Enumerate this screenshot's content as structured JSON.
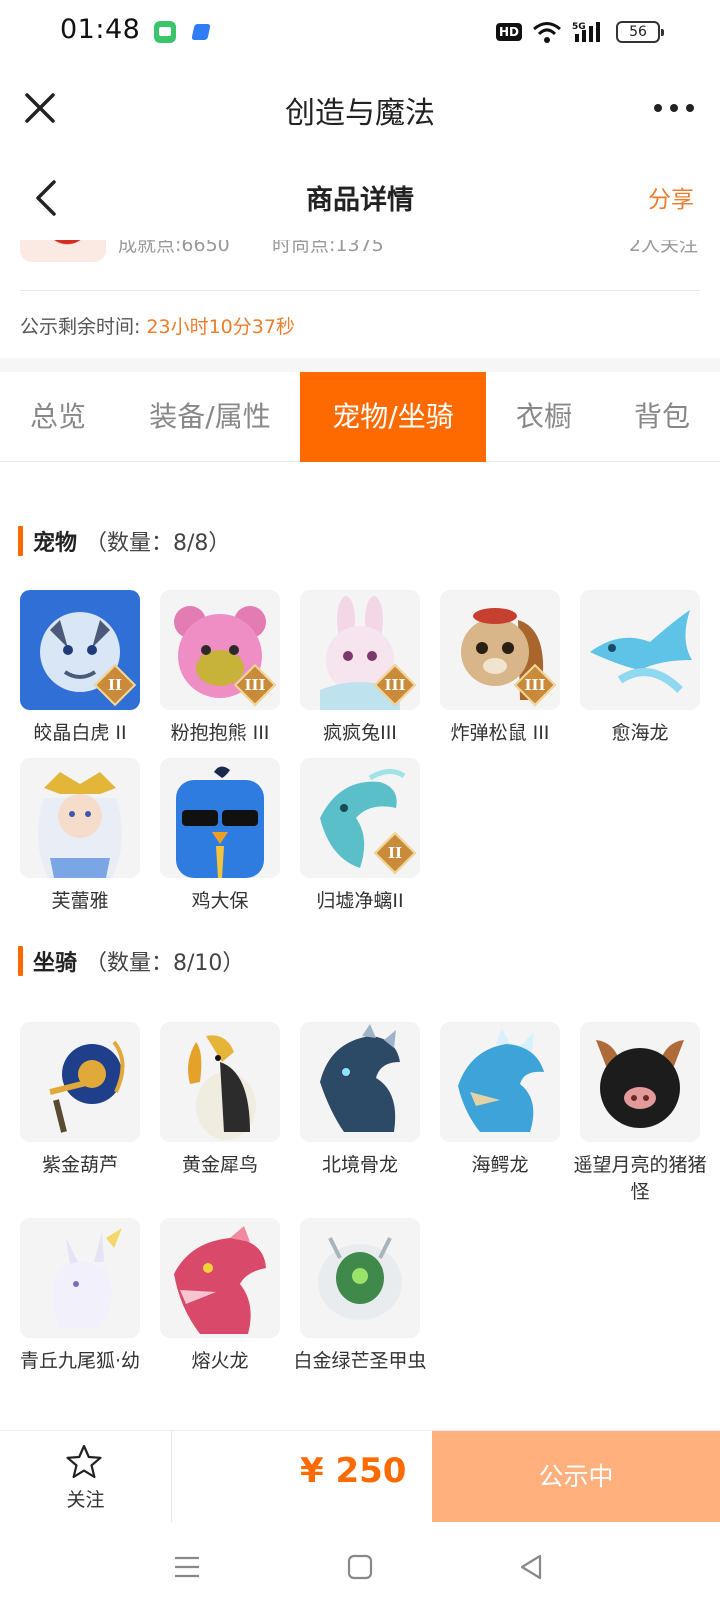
{
  "status_bar": {
    "time": "01:48",
    "network_badge": "HD",
    "network_type": "5G",
    "battery": "56"
  },
  "app_bar": {
    "title": "创造与魔法"
  },
  "page_header": {
    "title": "商品详情",
    "share_label": "分享"
  },
  "seller": {
    "achievement": "成就点:6650",
    "fashion": "时尚点:1375",
    "followers": "2人关注"
  },
  "countdown": {
    "label": "公示剩余时间:",
    "time": "23小时10分37秒"
  },
  "tabs": [
    {
      "label": "总览",
      "active": false
    },
    {
      "label": "装备/属性",
      "active": false
    },
    {
      "label": "宠物/坐骑",
      "active": true
    },
    {
      "label": "衣橱",
      "active": false
    },
    {
      "label": "背包",
      "active": false
    }
  ],
  "pets": {
    "title": "宠物",
    "count": "（数量：8/8）",
    "items": [
      {
        "name": "皎晶白虎 II",
        "tier": "II"
      },
      {
        "name": "粉抱抱熊 III",
        "tier": "III"
      },
      {
        "name": "疯疯兔III",
        "tier": "III"
      },
      {
        "name": "炸弹松鼠 III",
        "tier": "III"
      },
      {
        "name": "愈海龙",
        "tier": ""
      },
      {
        "name": "芙蕾雅",
        "tier": ""
      },
      {
        "name": "鸡大保",
        "tier": ""
      },
      {
        "name": "归墟净螭II",
        "tier": "II"
      }
    ]
  },
  "mounts": {
    "title": "坐骑",
    "count": "（数量：8/10）",
    "items": [
      {
        "name": "紫金葫芦"
      },
      {
        "name": "黄金犀鸟"
      },
      {
        "name": "北境骨龙"
      },
      {
        "name": "海鳄龙"
      },
      {
        "name": "遥望月亮的猪猪怪"
      },
      {
        "name": "青丘九尾狐·幼"
      },
      {
        "name": "熔火龙"
      },
      {
        "name": "白金绿芒圣甲虫"
      }
    ]
  },
  "bottom_bar": {
    "follow_label": "关注",
    "price": "¥ 250",
    "status_button": "公示中"
  },
  "colors": {
    "accent": "#ff6a00",
    "countdown": "#ec7d2c",
    "button_disabled": "#ffb07d"
  }
}
